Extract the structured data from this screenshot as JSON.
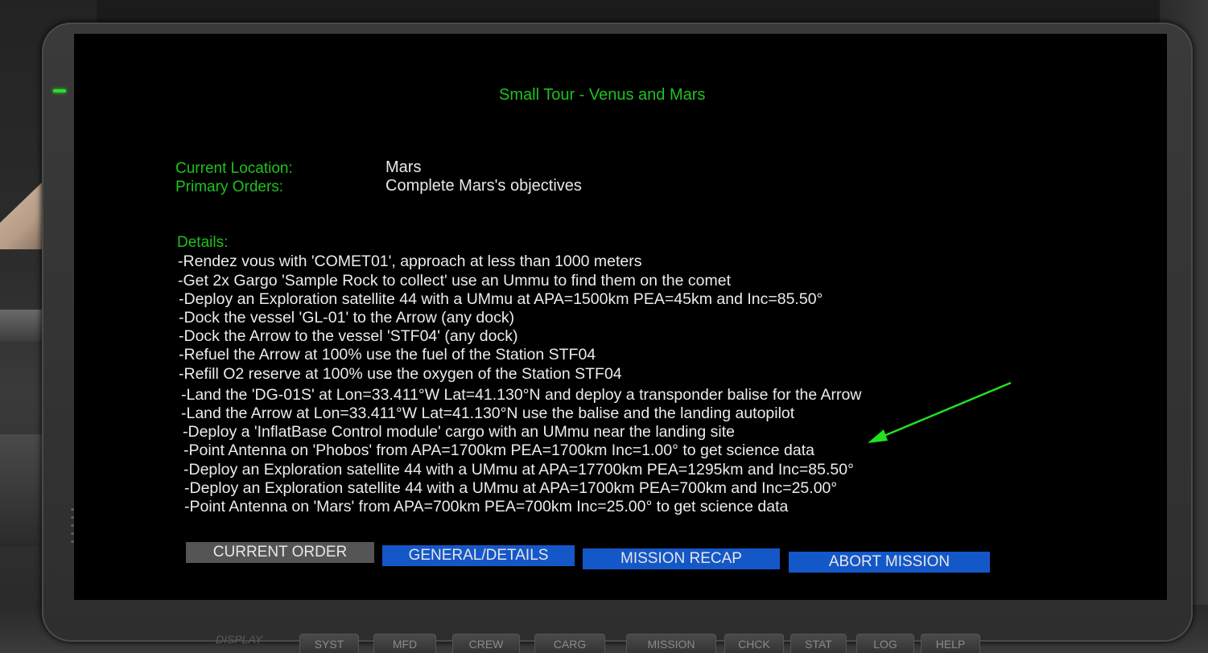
{
  "header": {
    "title": "Small Tour - Venus and Mars"
  },
  "status": {
    "current_location_label": "Current Location:",
    "current_location_value": "Mars",
    "primary_orders_label": "Primary Orders:",
    "primary_orders_value": "Complete Mars's objectives"
  },
  "details": {
    "heading": "Details:",
    "lines": [
      "-Rendez vous with 'COMET01', approach at less than 1000 meters",
      "-Get 2x Gargo 'Sample Rock to collect' use an Ummu to find them on the comet",
      "-Deploy an Exploration satellite 44 with a UMmu at APA=1500km PEA=45km and Inc=85.50°",
      "-Dock the vessel 'GL-01' to the Arrow (any dock)",
      "-Dock the Arrow to the vessel 'STF04' (any dock)",
      "-Refuel the Arrow at 100% use the fuel of the Station STF04",
      "-Refill O2 reserve at 100% use the oxygen of the Station STF04",
      "-Land the 'DG-01S' at Lon=33.411°W Lat=41.130°N and deploy a transponder balise for the Arrow",
      "-Land the Arrow at Lon=33.411°W Lat=41.130°N use the balise and the landing autopilot",
      "-Deploy a 'InflatBase Control module' cargo with an UMmu near the landing site",
      "-Point Antenna on 'Phobos' from APA=1700km PEA=1700km Inc=1.00° to get science data",
      "-Deploy an Exploration satellite 44 with a UMmu at APA=17700km PEA=1295km and Inc=85.50°",
      "-Deploy an Exploration satellite 44 with a UMmu at APA=1700km PEA=700km and Inc=25.00°",
      "-Point Antenna on 'Mars' from APA=700km PEA=700km Inc=25.00° to get science data"
    ]
  },
  "buttons": {
    "current_order": "CURRENT ORDER",
    "general_details": "GENERAL/DETAILS",
    "mission_recap": "MISSION RECAP",
    "abort_mission": "ABORT MISSION"
  },
  "keyboard": {
    "display_label": "DISPLAY",
    "keys": [
      "SYST",
      "MFD",
      "CREW",
      "CARG",
      "MISSION",
      "CHCK",
      "STAT",
      "LOG",
      "HELP"
    ]
  },
  "colors": {
    "green_text": "#20c020",
    "button_blue": "#1457c8",
    "button_gray": "#555555",
    "arrow": "#22e022"
  },
  "icons": {
    "annotation_arrow": "arrow-icon",
    "power_led": "power-led-icon"
  }
}
